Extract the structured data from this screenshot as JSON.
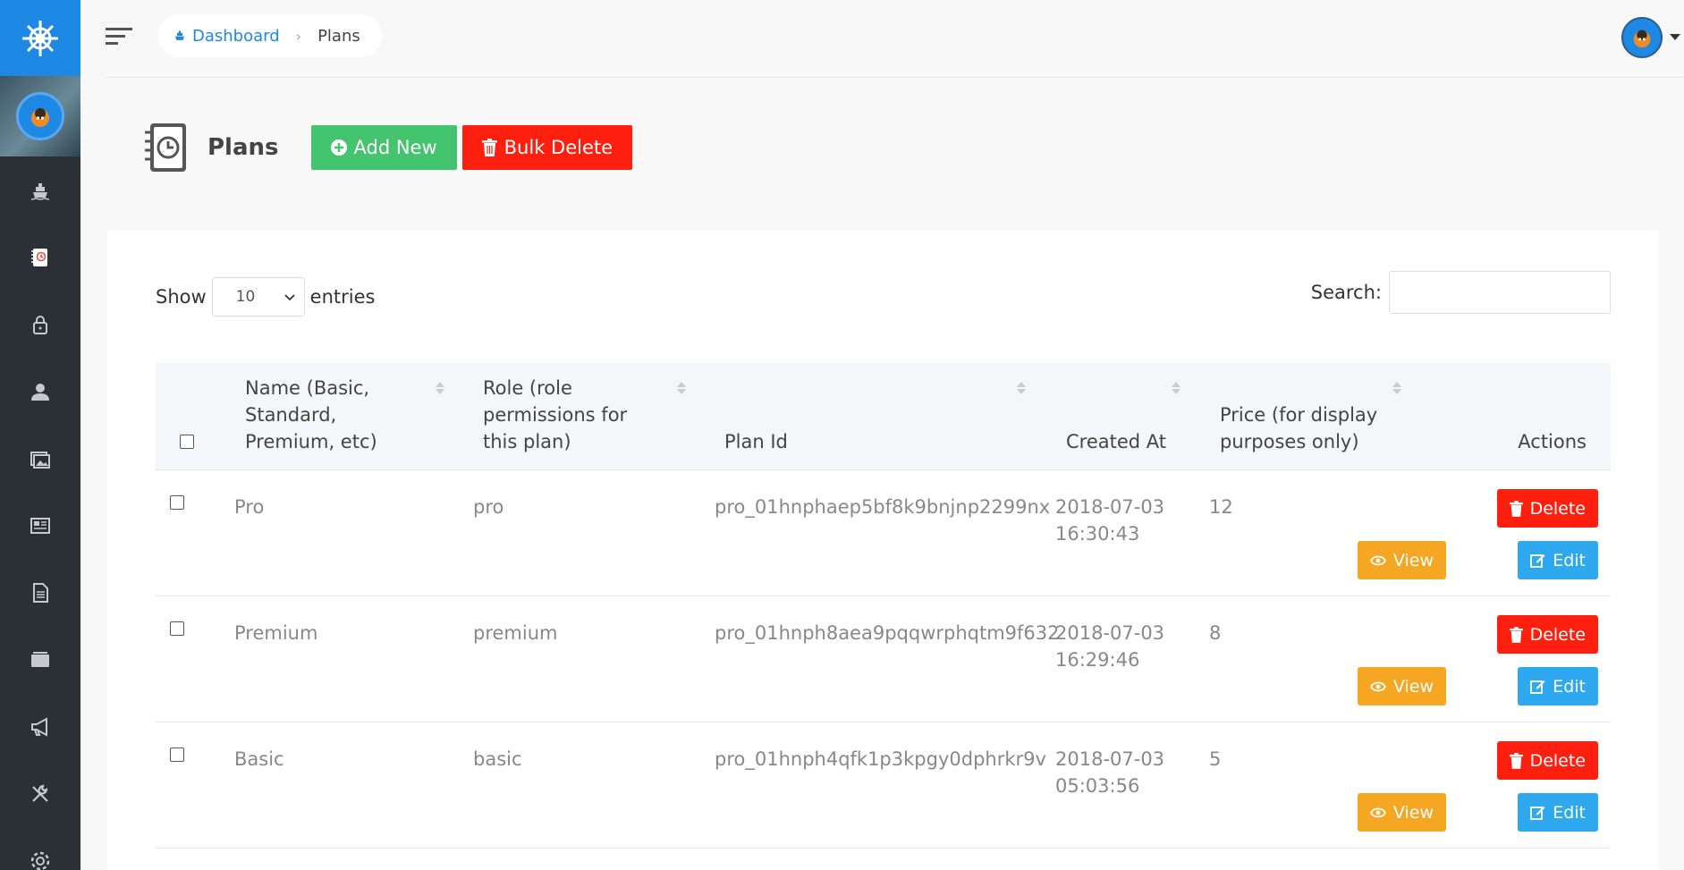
{
  "breadcrumb": {
    "home_label": "Dashboard",
    "current_label": "Plans"
  },
  "page": {
    "title": "Plans",
    "add_new_label": "Add New",
    "bulk_delete_label": "Bulk Delete"
  },
  "length_control": {
    "show_label": "Show",
    "value": "10",
    "entries_label": "entries"
  },
  "search": {
    "label": "Search:",
    "value": ""
  },
  "table": {
    "columns": [
      "Name (Basic, Standard, Premium, etc)",
      "Role (role permissions for this plan)",
      "Plan Id",
      "Created At",
      "Price (for display purposes only)",
      "Actions"
    ],
    "rows": [
      {
        "name": "Pro",
        "role": "pro",
        "plan_id": "pro_01hnphaep5bf8k9bnjnp2299nx",
        "created_date": "2018-07-03",
        "created_time": "16:30:43",
        "price": "12"
      },
      {
        "name": "Premium",
        "role": "premium",
        "plan_id": "pro_01hnph8aea9pqqwrphqtm9f632",
        "created_date": "2018-07-03",
        "created_time": "16:29:46",
        "price": "8"
      },
      {
        "name": "Basic",
        "role": "basic",
        "plan_id": "pro_01hnph4qfk1p3kpgy0dphrkr9v",
        "created_date": "2018-07-03",
        "created_time": "05:03:56",
        "price": "5"
      }
    ],
    "actions": {
      "delete_label": "Delete",
      "view_label": "View",
      "edit_label": "Edit"
    }
  },
  "sidebar": {
    "items": [
      "ship-icon",
      "plans-icon",
      "lock-icon",
      "user-icon",
      "images-icon",
      "newspaper-icon",
      "document-icon",
      "folder-icon",
      "megaphone-icon",
      "tools-icon",
      "settings-icon"
    ]
  },
  "colors": {
    "primary": "#1e88e5",
    "success": "#45c46f",
    "danger": "#ff1f0e",
    "warning": "#f5a623",
    "info": "#2ea8ef",
    "sidebar": "#2b2f36"
  }
}
